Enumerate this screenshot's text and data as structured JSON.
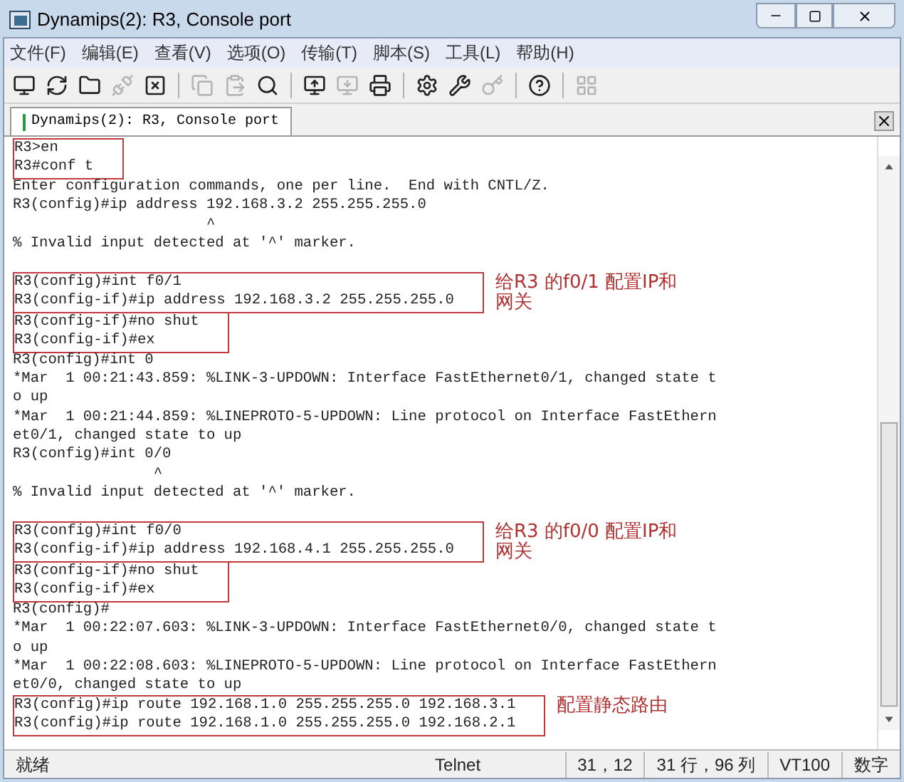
{
  "window": {
    "title": "Dynamips(2): R3, Console port"
  },
  "menu": [
    "文件(F)",
    "编辑(E)",
    "查看(V)",
    "选项(O)",
    "传输(T)",
    "脚本(S)",
    "工具(L)",
    "帮助(H)"
  ],
  "toolbar": [
    [
      {
        "disabled": false
      },
      {
        "disabled": false
      },
      {
        "disabled": false
      },
      {
        "disabled": true
      },
      {
        "disabled": false
      }
    ],
    [
      {
        "disabled": true
      },
      {
        "disabled": true
      },
      {
        "disabled": false
      }
    ],
    [
      {
        "disabled": false
      },
      {
        "disabled": true
      },
      {
        "disabled": false
      }
    ],
    [
      {
        "disabled": false
      },
      {
        "disabled": false
      },
      {
        "disabled": true
      }
    ],
    [
      {
        "disabled": false
      }
    ],
    [
      {
        "disabled": true
      }
    ]
  ],
  "tabs": [
    {
      "label": "Dynamips(2): R3, Console port",
      "selected": true
    }
  ],
  "terminal": {
    "blocks": [
      {
        "kind": "boxed",
        "lines": [
          "R3>en",
          "R3#conf t"
        ]
      },
      {
        "kind": "plain",
        "lines": [
          "Enter configuration commands, one per line.  End with CNTL/Z.",
          "R3(config)#ip address 192.168.3.2 255.255.255.0",
          "                      ^",
          "% Invalid input detected at '^' marker."
        ]
      },
      {
        "kind": "gap"
      },
      {
        "kind": "boxed",
        "lines": [
          "R3(config)#int f0/1",
          "R3(config-if)#ip address 192.168.3.2 255.255.255.0"
        ],
        "note": "给R3 的f0/1 配置IP和网关"
      },
      {
        "kind": "boxed",
        "lines": [
          "R3(config-if)#no shut",
          "R3(config-if)#ex"
        ]
      },
      {
        "kind": "plain",
        "lines": [
          "R3(config)#int 0",
          "*Mar  1 00:21:43.859: %LINK-3-UPDOWN: Interface FastEthernet0/1, changed state t",
          "o up",
          "*Mar  1 00:21:44.859: %LINEPROTO-5-UPDOWN: Line protocol on Interface FastEthern",
          "et0/1, changed state to up",
          "R3(config)#int 0/0",
          "                ^",
          "% Invalid input detected at '^' marker."
        ]
      },
      {
        "kind": "gap"
      },
      {
        "kind": "boxed",
        "lines": [
          "R3(config)#int f0/0",
          "R3(config-if)#ip address 192.168.4.1 255.255.255.0"
        ],
        "note": "给R3 的f0/0 配置IP和网关"
      },
      {
        "kind": "boxed",
        "lines": [
          "R3(config-if)#no shut",
          "R3(config-if)#ex"
        ]
      },
      {
        "kind": "plain",
        "lines": [
          "R3(config)#",
          "*Mar  1 00:22:07.603: %LINK-3-UPDOWN: Interface FastEthernet0/0, changed state t",
          "o up",
          "*Mar  1 00:22:08.603: %LINEPROTO-5-UPDOWN: Line protocol on Interface FastEthern",
          "et0/0, changed state to up"
        ]
      },
      {
        "kind": "boxed",
        "lines": [
          "R3(config)#ip route 192.168.1.0 255.255.255.0 192.168.3.1",
          "R3(config)#ip route 192.168.1.0 255.255.255.0 192.168.2.1"
        ],
        "note": "配置静态路由"
      }
    ]
  },
  "status_bar": [
    "就绪",
    "Telnet",
    "31，12",
    "31 行，96 列",
    "VT100",
    "数字"
  ]
}
